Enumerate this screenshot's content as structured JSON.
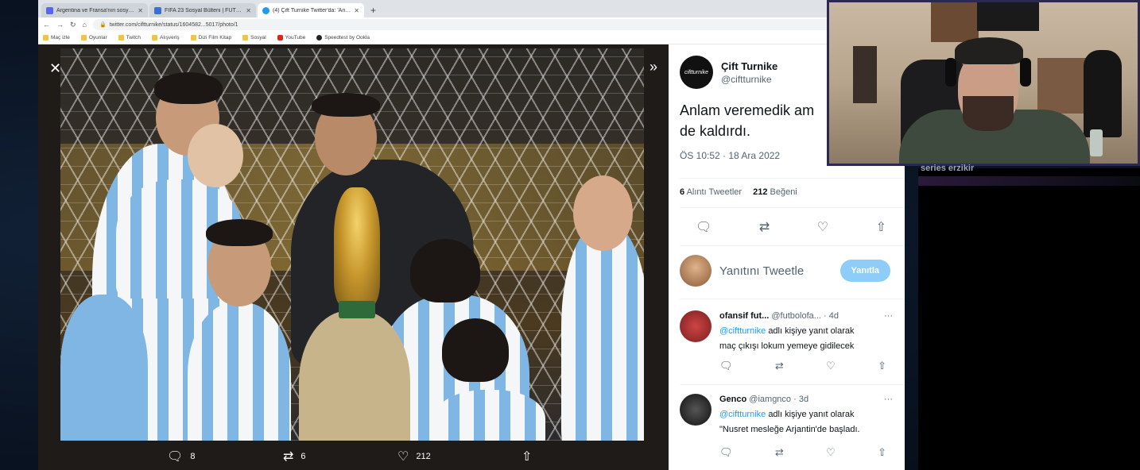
{
  "browser": {
    "tabs": [
      {
        "label": "Argentina ve Fransa'nın sosyal...",
        "favicon_color": "#5865f2",
        "active": false
      },
      {
        "label": "FIFA 23 Sosyal Bülteni | FUTBIN",
        "favicon_color": "#3a6fd8",
        "active": false
      },
      {
        "label": "(4) Çift Turnike Twitter'da: 'Anlam...",
        "favicon_color": "#1d9bf0",
        "active": true
      }
    ],
    "url": "twitter.com/ciftturnike/status/1604582...5017/photo/1",
    "bookmarks": [
      {
        "label": "Maç izle",
        "icon": "folder-icon"
      },
      {
        "label": "Oyunlar",
        "icon": "folder-icon"
      },
      {
        "label": "Twitch",
        "icon": "folder-icon"
      },
      {
        "label": "Alışveriş",
        "icon": "folder-icon"
      },
      {
        "label": "Dizi Film Kitap",
        "icon": "folder-icon"
      },
      {
        "label": "Sosyal",
        "icon": "folder-icon"
      },
      {
        "label": "YouTube",
        "icon": "youtube-icon"
      },
      {
        "label": "Speedtest by Ookla",
        "icon": "speedtest-icon"
      }
    ]
  },
  "viewer": {
    "close_glyph": "✕",
    "next_glyph": "»",
    "actions": {
      "replies": "8",
      "retweets": "6",
      "likes": "212"
    }
  },
  "tweet": {
    "author_name": "Çift Turnike",
    "author_handle": "@ciftturnike",
    "avatar_text": "ciftturnike",
    "text": "Anlam veremedik am\nde kaldırdı.",
    "time": "ÖS 10:52 · 18 Ara 2022",
    "quote_count": "6",
    "quote_label": "Alıntı Tweetler",
    "like_count": "212",
    "like_label": "Beğeni",
    "reply_placeholder": "Yanıtını Tweetle",
    "reply_button": "Yanıtla"
  },
  "replies": [
    {
      "name": "ofansif fut...",
      "handle": "@futbolofa...",
      "age": "· 4d",
      "reply_to_prefix": "@ciftturnike",
      "reply_to_suffix": "adlı kişiye yanıt olarak",
      "text": "maç çıkışı lokum yemeye gidilecek"
    },
    {
      "name": "Genco",
      "handle": "@iamgnco",
      "age": "· 3d",
      "reply_to_prefix": "@ciftturnike",
      "reply_to_suffix": "adlı kişiye yanıt olarak",
      "text": "\"Nusret mesleğe Arjantin'de başladı."
    }
  ],
  "overlay": {
    "panel_title": "series erzikir"
  },
  "colors": {
    "twitter_blue": "#1d9bf0",
    "reply_button": "#8ecdf8",
    "viewer_bg": "#1f1b19"
  }
}
